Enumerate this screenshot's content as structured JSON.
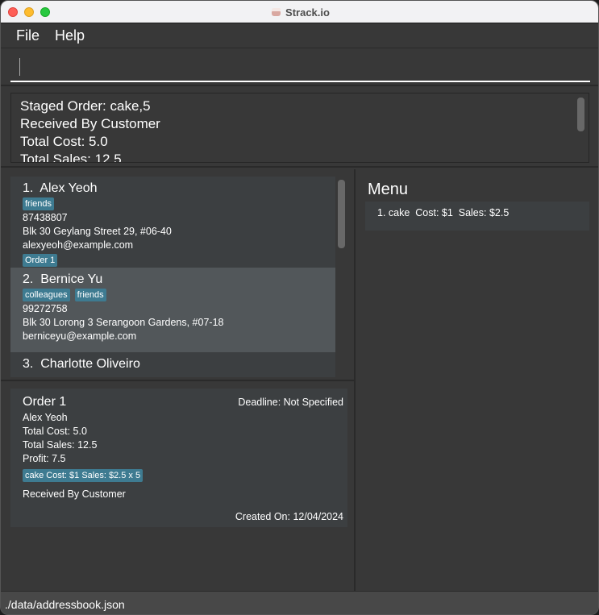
{
  "window": {
    "title": "Strack.io",
    "app_icon": "cake-icon"
  },
  "menubar": {
    "items": [
      "File",
      "Help"
    ]
  },
  "command": {
    "value": "",
    "placeholder": ""
  },
  "result": {
    "lines": [
      "Staged Order: cake,5",
      "Received By Customer",
      "Total Cost: 5.0",
      "Total Sales: 12.5"
    ]
  },
  "persons": [
    {
      "index": "1.",
      "name": "Alex Yeoh",
      "tags": [
        "friends"
      ],
      "phone": "87438807",
      "address": "Blk 30 Geylang Street 29, #06-40",
      "email": "alexyeoh@example.com",
      "orders": [
        "Order 1"
      ]
    },
    {
      "index": "2.",
      "name": "Bernice Yu",
      "tags": [
        "colleagues",
        "friends"
      ],
      "phone": "99272758",
      "address": "Blk 30 Lorong 3 Serangoon Gardens, #07-18",
      "email": "berniceyu@example.com",
      "orders": []
    },
    {
      "index": "3.",
      "name": "Charlotte Oliveiro"
    }
  ],
  "order": {
    "title": "Order 1",
    "deadline": "Deadline: Not Specified",
    "customer": "Alex Yeoh",
    "total_cost": "Total Cost: 5.0",
    "total_sales": "Total Sales: 12.5",
    "profit": "Profit: 7.5",
    "item_tag": "cake Cost: $1 Sales: $2.5 x 5",
    "status": "Received By Customer",
    "created_on": "Created On: 12/04/2024"
  },
  "menu_panel": {
    "title": "Menu",
    "items": [
      "1. cake  Cost: $1  Sales: $2.5"
    ]
  },
  "statusbar": {
    "path": "./data/addressbook.json"
  },
  "colors": {
    "background": "#383838",
    "card": "#3c3f41",
    "selected_card": "#52575a",
    "tag": "#3e7b91",
    "statusbar": "#484848"
  }
}
